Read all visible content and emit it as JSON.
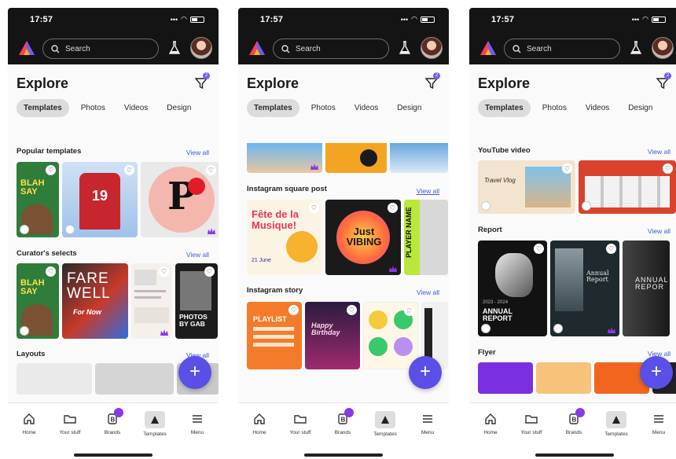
{
  "screens": [
    {
      "status": {
        "time": "17:57"
      },
      "search": {
        "placeholder": "Search"
      },
      "explore": {
        "title": "Explore",
        "filter_count": "2"
      },
      "tabs": [
        "Templates",
        "Photos",
        "Videos",
        "Design"
      ],
      "sections": [
        {
          "title": "Popular templates",
          "view_all": "View all"
        },
        {
          "title": "Curator's selects",
          "view_all": "View all"
        },
        {
          "title": "Layouts",
          "view_all": "View all"
        }
      ],
      "card_texts": {
        "blah": "BLAH SAY",
        "jersey": "19",
        "p": "P",
        "fare": "FARE WELL",
        "for_now": "For Now",
        "photos": "PHOTOS BY GAB"
      }
    },
    {
      "status": {
        "time": "17:57"
      },
      "search": {
        "placeholder": "Search"
      },
      "explore": {
        "title": "Explore",
        "filter_count": "2"
      },
      "tabs": [
        "Templates",
        "Photos",
        "Videos",
        "Design"
      ],
      "sections": [
        {
          "title": "Instagram square post",
          "view_all": "View all"
        },
        {
          "title": "Instagram story",
          "view_all": "View all"
        }
      ],
      "card_texts": {
        "fete": "Fête de la Musique!",
        "fete_date": "21 June",
        "just": "Just VIBING",
        "player": "PLAYER NAME",
        "playlist": "PLAYLIST",
        "birthday": "Happy Birthday"
      }
    },
    {
      "status": {
        "time": "17:57"
      },
      "search": {
        "placeholder": "Search"
      },
      "explore": {
        "title": "Explore",
        "filter_count": "2"
      },
      "tabs": [
        "Templates",
        "Photos",
        "Videos",
        "Design"
      ],
      "sections": [
        {
          "title": "YouTube video",
          "view_all": "View all"
        },
        {
          "title": "Report",
          "view_all": "View all"
        },
        {
          "title": "Flyer",
          "view_all": "View all"
        }
      ],
      "card_texts": {
        "travel": "Travel Vlog",
        "annual": "ANNUAL REPORT",
        "annual_years": "2023 - 2024",
        "annual2": "Annual Report",
        "annual3": "ANNUAL REPOR"
      }
    }
  ],
  "nav": [
    "Home",
    "Your stuff",
    "Brands",
    "Templates",
    "Menu"
  ],
  "colors": {
    "accent": "#5a4fe6",
    "link": "#3d5be0",
    "topbar": "#141414",
    "brand_badge": "#8a39e6"
  }
}
